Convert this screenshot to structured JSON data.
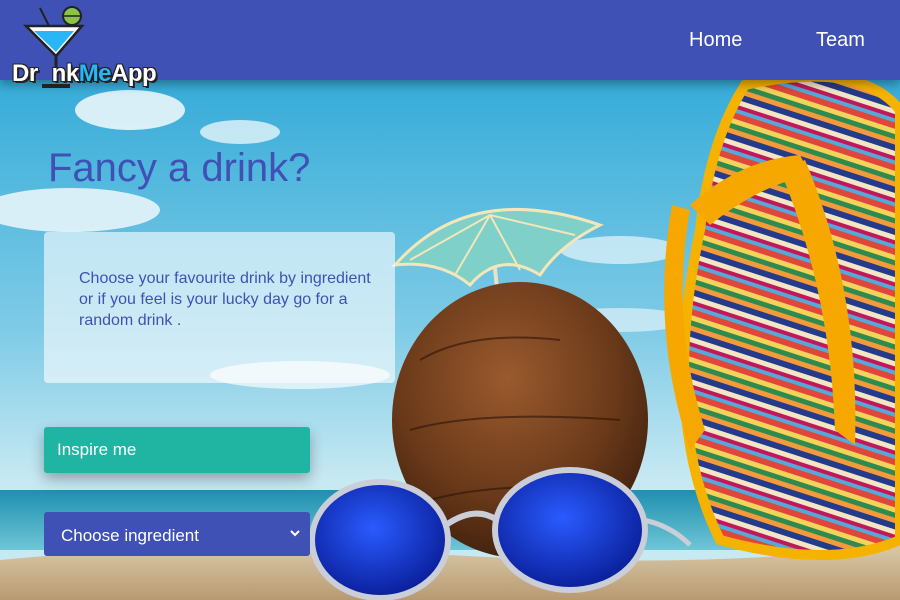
{
  "app": {
    "logo_text_part1": "Dr",
    "logo_text_part2": "nk",
    "logo_text_part3": "Me",
    "logo_text_part4": "App"
  },
  "nav": {
    "items": [
      {
        "label": "Home"
      },
      {
        "label": "Team"
      }
    ]
  },
  "hero": {
    "headline": "Fancy a drink?",
    "description": "Choose your favourite drink by ingredient or if you feel is your lucky day go for a random drink ."
  },
  "actions": {
    "inspire_label": "Inspire me",
    "ingredient_select": {
      "selected": "Choose ingredient"
    }
  },
  "colors": {
    "primary": "#3f51b5",
    "accent": "#20b5a2",
    "logo_accent": "#29b6f6"
  },
  "icons": {
    "logo": "cocktail-glass-icon",
    "select": "chevron-down-icon"
  }
}
